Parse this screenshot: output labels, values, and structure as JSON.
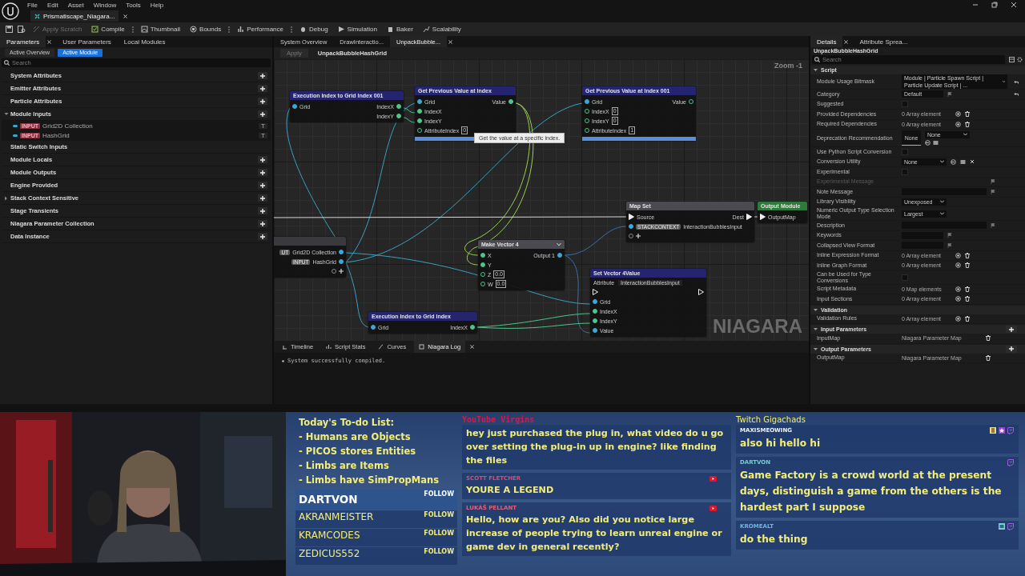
{
  "menu": [
    "File",
    "Edit",
    "Asset",
    "Window",
    "Tools",
    "Help"
  ],
  "document_tab": {
    "label": "Prismatiscape_Niagara...",
    "selected": true
  },
  "toolbar": [
    {
      "label": "Apply Scratch",
      "disabled": true,
      "kind": "scratch",
      "menu": false
    },
    {
      "label": "Compile",
      "disabled": false,
      "kind": "compile",
      "menu": true
    },
    {
      "label": "Thumbnail",
      "disabled": false,
      "kind": "thumbnail",
      "menu": false
    },
    {
      "label": "Bounds",
      "disabled": false,
      "kind": "bounds",
      "menu": true
    },
    {
      "label": "Performance",
      "disabled": false,
      "kind": "performance",
      "menu": true
    },
    {
      "label": "Debug",
      "disabled": false,
      "kind": "debug",
      "menu": false
    },
    {
      "label": "Simulation",
      "disabled": false,
      "kind": "simulation",
      "menu": false
    },
    {
      "label": "Baker",
      "disabled": false,
      "kind": "baker",
      "menu": false
    },
    {
      "label": "Scalability",
      "disabled": false,
      "kind": "scalability",
      "menu": false
    }
  ],
  "parameters": {
    "tabs": [
      {
        "label": "Parameters",
        "selected": true
      },
      {
        "label": "User Parameters",
        "selected": false
      },
      {
        "label": "Local Modules",
        "selected": false
      }
    ],
    "modes": [
      {
        "label": "Active Overview",
        "selected": false
      },
      {
        "label": "Active Module",
        "selected": true
      }
    ],
    "search": {
      "placeholder": "Search"
    },
    "categories": [
      {
        "name": "System Attributes",
        "expanded": false,
        "addable": true
      },
      {
        "name": "Emitter Attributes",
        "expanded": false,
        "addable": true
      },
      {
        "name": "Particle Attributes",
        "expanded": false,
        "addable": true
      },
      {
        "name": "Module Inputs",
        "expanded": true,
        "addable": true,
        "children": [
          {
            "badge": "INPUT",
            "name": "Grid2D Collection"
          },
          {
            "badge": "INPUT",
            "name": "HashGrid"
          }
        ]
      },
      {
        "name": "Static Switch Inputs",
        "expanded": false,
        "addable": false
      },
      {
        "name": "Module Locals",
        "expanded": false,
        "addable": true
      },
      {
        "name": "Module Outputs",
        "expanded": false,
        "addable": true
      },
      {
        "name": "Engine Provided",
        "expanded": false,
        "addable": true
      },
      {
        "name": "Stack Context Sensitive",
        "expanded": false,
        "collapsible": true,
        "addable": true
      },
      {
        "name": "Stage Transients",
        "expanded": false,
        "addable": true
      },
      {
        "name": "Niagara Parameter Collection",
        "expanded": false,
        "addable": true
      },
      {
        "name": "Data Instance",
        "expanded": false,
        "addable": true
      }
    ]
  },
  "graph": {
    "tabs": [
      {
        "label": "System Overview",
        "selected": false
      },
      {
        "label": "DrawInteractio...",
        "selected": false
      },
      {
        "label": "UnpackBubble...",
        "selected": true
      }
    ],
    "apply": {
      "label": "Apply",
      "disabled": true
    },
    "title": "UnpackBubbleHashGrid",
    "zoom": "Zoom -1",
    "watermark": "NIAGARA",
    "tooltip": "Get the value at a specific index.",
    "nodes": [
      {
        "title": "Execution Index to Grid Index 001",
        "kind": "function",
        "footer_bar": false,
        "rows": [
          {
            "left": {
              "name": "Grid",
              "kind": "grid",
              "connected": true
            },
            "right": {
              "name": "IndexX",
              "kind": "int",
              "connected": true
            }
          },
          {
            "right": {
              "name": "IndexY",
              "kind": "int",
              "connected": true
            }
          }
        ]
      },
      {
        "title": "Get Previous Value at Index",
        "kind": "function",
        "footer_bar": true,
        "rows": [
          {
            "left": {
              "name": "Grid",
              "kind": "grid",
              "connected": true
            },
            "right": {
              "name": "Value",
              "kind": "int",
              "connected": true
            }
          },
          {
            "left": {
              "name": "IndexX",
              "kind": "int",
              "connected": true
            }
          },
          {
            "left": {
              "name": "IndexY",
              "kind": "int",
              "connected": true
            }
          },
          {
            "left": {
              "name": "AttributeIndex",
              "kind": "int",
              "connected": false,
              "value": "0"
            }
          }
        ]
      },
      {
        "title": "Get Previous Value at Index 001",
        "kind": "function",
        "footer_bar": true,
        "rows": [
          {
            "left": {
              "name": "Grid",
              "kind": "grid",
              "connected": true
            },
            "right": {
              "name": "Value",
              "kind": "int",
              "connected": false
            }
          },
          {
            "left": {
              "name": "IndexX",
              "kind": "int",
              "connected": false,
              "value": "0"
            }
          },
          {
            "left": {
              "name": "IndexY",
              "kind": "int",
              "connected": false,
              "value": "0"
            }
          },
          {
            "left": {
              "name": "AttributeIndex",
              "kind": "int",
              "connected": false,
              "value": "1"
            }
          }
        ]
      },
      {
        "kind": "input",
        "footer_bar": false,
        "rows": [
          {
            "right": {
              "badge": "UT",
              "name": "Grid2D Collection",
              "kind": "grid",
              "connected": true
            }
          },
          {
            "right": {
              "badge": "INPUT",
              "name": "HashGrid",
              "kind": "grid",
              "connected": true
            }
          },
          {
            "right": {
              "kind": "add",
              "connected": false
            }
          }
        ]
      },
      {
        "title": "Make Vector 4",
        "kind": "vector",
        "footer_bar": false,
        "rows": [
          {
            "left": {
              "name": "X",
              "kind": "int",
              "connected": true
            },
            "right": {
              "name": "Output 1",
              "kind": "grid",
              "connected": true
            }
          },
          {
            "left": {
              "name": "Y",
              "kind": "int",
              "connected": true
            }
          },
          {
            "left": {
              "name": "Z",
              "kind": "int",
              "connected": false,
              "value": "0.0"
            }
          },
          {
            "left": {
              "name": "W",
              "kind": "int",
              "connected": false,
              "value": "0.0"
            }
          }
        ]
      },
      {
        "title": "Map Set",
        "kind": "map",
        "footer_bar": false,
        "rows": [
          {
            "left": {
              "name": "Source",
              "kind": "exec",
              "connected": true
            },
            "right": {
              "name": "Dest",
              "kind": "exec",
              "connected": true
            }
          },
          {
            "left": {
              "badge": "STACKCONTEXT",
              "name": "InteractionBubblesInput",
              "kind": "grid",
              "connected": true
            }
          },
          {
            "left": {
              "kind": "add",
              "connected": false
            }
          }
        ]
      },
      {
        "title": "Output Module",
        "kind": "output",
        "footer_bar": false,
        "rows": [
          {
            "left": {
              "name": "OutputMap",
              "kind": "exec",
              "connected": true
            }
          }
        ]
      },
      {
        "title": "Set Vector 4Value",
        "kind": "function",
        "footer_bar": false,
        "attribute": {
          "label": "Attribute",
          "value": "InteractionBubblesInput"
        },
        "rows": [
          {
            "left": {
              "kind": "exec",
              "connected": false
            },
            "right": {
              "kind": "exec",
              "connected": false
            }
          },
          {
            "left": {
              "name": "Grid",
              "kind": "grid",
              "connected": true
            }
          },
          {
            "left": {
              "name": "IndexX",
              "kind": "int",
              "connected": true
            }
          },
          {
            "left": {
              "name": "IndexY",
              "kind": "int",
              "connected": true
            }
          },
          {
            "left": {
              "name": "Value",
              "kind": "grid",
              "connected": true
            }
          }
        ]
      },
      {
        "title": "Execution Index to Grid Index",
        "kind": "function",
        "footer_bar": false,
        "rows": [
          {
            "left": {
              "name": "Grid",
              "kind": "grid",
              "connected": true
            },
            "right": {
              "name": "IndexX",
              "kind": "int",
              "connected": true
            }
          }
        ]
      }
    ],
    "bottom_tabs": [
      {
        "label": "Timeline",
        "selected": false,
        "kind": "timeline"
      },
      {
        "label": "Script Stats",
        "selected": false,
        "kind": "stats"
      },
      {
        "label": "Curves",
        "selected": false,
        "kind": "curves"
      },
      {
        "label": "Niagara Log",
        "selected": true,
        "kind": "log"
      }
    ],
    "log": [
      "System successfully compiled."
    ]
  },
  "details": {
    "tabs": [
      {
        "label": "Details",
        "selected": true
      },
      {
        "label": "Attribute Sprea...",
        "selected": false
      }
    ],
    "title": "UnpackBubbleHashGrid",
    "search": {
      "placeholder": "Search"
    },
    "sections": [
      {
        "name": "Script",
        "addable": false,
        "rows": [
          {
            "label": "Module Usage Bitmask",
            "kind": "dropdown_wide",
            "value": "Module | Particle Spawn Script | Particle Update Script | ...",
            "resettable": true,
            "disabled": false
          },
          {
            "label": "Category",
            "kind": "text",
            "value": "Default",
            "resettable": true,
            "disabled": false
          },
          {
            "label": "Suggested",
            "kind": "checkbox",
            "checked": false,
            "resettable": false,
            "disabled": false
          },
          {
            "label": "Provided Dependencies",
            "kind": "array",
            "value": "0 Array element",
            "resettable": false,
            "disabled": false
          },
          {
            "label": "Required Dependencies",
            "kind": "array",
            "value": "0 Array element",
            "resettable": false,
            "disabled": false
          },
          {
            "label": "Deprecation Recommendation",
            "kind": "asset",
            "thumbnail": "None",
            "value": "None",
            "resettable": false,
            "disabled": false
          },
          {
            "label": "Use Python Script Conversion",
            "kind": "checkbox",
            "checked": false,
            "resettable": false,
            "disabled": false
          },
          {
            "label": "Conversion Utility",
            "kind": "dropdown_tools",
            "value": "None",
            "resettable": false,
            "disabled": false
          },
          {
            "label": "Experimental",
            "kind": "checkbox",
            "checked": false,
            "resettable": false,
            "disabled": false
          },
          {
            "label": "Experimental Message",
            "kind": "text_wide",
            "resettable": false,
            "disabled": true
          },
          {
            "label": "Note Message",
            "kind": "text_wide",
            "resettable": false,
            "disabled": false
          },
          {
            "label": "Library Visibility",
            "kind": "dropdown",
            "value": "Unexposed",
            "resettable": false,
            "disabled": false
          },
          {
            "label": "Numeric Output Type Selection Mode",
            "kind": "dropdown",
            "value": "Largest",
            "resettable": false,
            "disabled": false
          },
          {
            "label": "Description",
            "kind": "text_wide",
            "resettable": false,
            "disabled": false
          },
          {
            "label": "Keywords",
            "kind": "text",
            "resettable": false,
            "disabled": false
          },
          {
            "label": "Collapsed View Format",
            "kind": "text",
            "resettable": false,
            "disabled": false
          },
          {
            "label": "Inline Expression Format",
            "kind": "array",
            "value": "0 Array element",
            "resettable": false,
            "disabled": false
          },
          {
            "label": "Inline Graph Format",
            "kind": "array",
            "value": "0 Array element",
            "resettable": false,
            "disabled": false
          },
          {
            "label": "Can be Used for Type Conversions",
            "kind": "checkbox",
            "checked": false,
            "resettable": false,
            "disabled": false
          },
          {
            "label": "Script Metadata",
            "kind": "array",
            "value": "0 Map elements",
            "resettable": false,
            "disabled": false
          },
          {
            "label": "Input Sections",
            "kind": "array",
            "value": "0 Array element",
            "resettable": false,
            "disabled": false
          }
        ]
      },
      {
        "name": "Validation",
        "addable": false,
        "rows": [
          {
            "label": "Validation Rules",
            "kind": "array",
            "value": "0 Array element",
            "resettable": false,
            "disabled": false
          }
        ]
      },
      {
        "name": "Input Parameters",
        "addable": true,
        "rows": [
          {
            "label": "InputMap",
            "kind": "param",
            "value": "Niagara Parameter Map",
            "resettable": false,
            "disabled": false
          }
        ]
      },
      {
        "name": "Output Parameters",
        "addable": true,
        "rows": [
          {
            "label": "OutputMap",
            "kind": "param",
            "value": "Niagara Parameter Map",
            "resettable": false,
            "disabled": false
          }
        ]
      }
    ]
  },
  "todo": {
    "title": "Today's To-do List:",
    "items": [
      "- Humans are Objects",
      "- PICOS stores Entities",
      "- Limbs are Items",
      "- Limbs have SimPropMans"
    ]
  },
  "followers": [
    {
      "name": "DARTVON",
      "action": "FOLLOW",
      "highlighted": true
    },
    {
      "name": "AKRANMEISTER",
      "action": "FOLLOW",
      "highlighted": false
    },
    {
      "name": "KRAMCODES",
      "action": "FOLLOW",
      "highlighted": false
    },
    {
      "name": "ZEDICUS552",
      "action": "FOLLOW",
      "highlighted": false
    }
  ],
  "youtube_chat": {
    "title": "YouTube Virgins",
    "messages": [
      {
        "text": "hey just purchased the plug in, what video do u go over setting the plug-in up in engine? like finding the files"
      },
      {
        "author": "SCOTT FLETCHER",
        "color": "#e04a6a",
        "text": "YOURE A LEGEND",
        "kind": "youtube"
      },
      {
        "author": "LUKÁŠ PELLANT",
        "color": "#e0607a",
        "text": "Hello, how are you? Also did you notice large increase of people trying to learn unreal engine or game dev in general recently?",
        "kind": "youtube"
      }
    ]
  },
  "twitch_chat": {
    "title": "Twitch Gigachads",
    "messages": [
      {
        "author": "MAXISMEOWING",
        "color": "#f2f2f2",
        "text": "also hi hello hi",
        "kind": "twitch_badges"
      },
      {
        "author": "DARTVON",
        "color": "#6fd3c8",
        "text": "Game Factory is a crowd world at the present days, distinguish a game from the others is the hardest part I suppose",
        "kind": "twitch"
      },
      {
        "author": "KROMEALT",
        "color": "#6fb6e0",
        "text": "do the thing",
        "kind": "twitch_badge"
      }
    ]
  }
}
